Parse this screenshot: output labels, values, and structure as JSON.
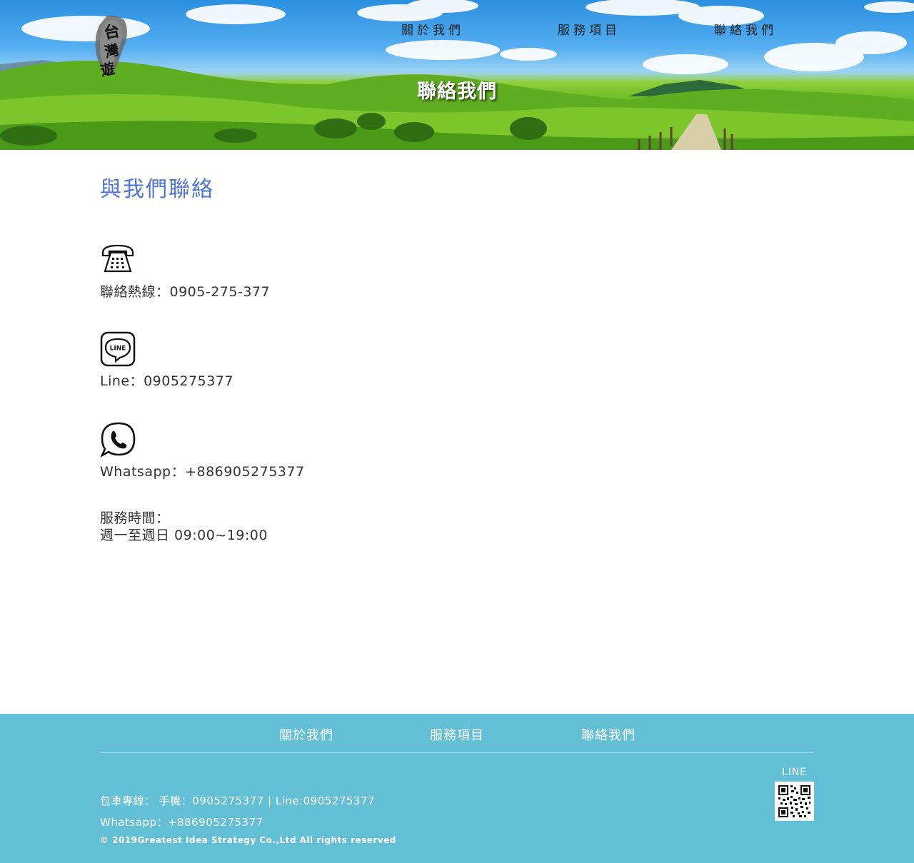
{
  "header": {
    "logo_text": "台灣遊",
    "nav": [
      "關於我們",
      "服務項目",
      "聯絡我們"
    ],
    "title": "聯絡我們"
  },
  "main": {
    "heading": "與我們聯絡",
    "contacts": [
      {
        "icon": "telephone-icon",
        "text": "聯絡熱線：0905-275-377"
      },
      {
        "icon": "line-icon",
        "text": "Line：0905275377"
      },
      {
        "icon": "whatsapp-icon",
        "text": "Whatsapp：+886905275377"
      }
    ],
    "hours_label": "服務時間：",
    "hours_value": "週一至週日 09:00~19:00"
  },
  "footer": {
    "nav": [
      "關於我們",
      "服務項目",
      "聯絡我們"
    ],
    "hotline": "包車專線： 手機：0905275377 | Line:0905275377",
    "whatsapp": "Whatsapp：+886905275377",
    "copyright": "© 2019Greatest Idea Strategy Co.,Ltd All rights reserved",
    "qr_label": "LINE"
  },
  "colors": {
    "heading_blue": "#4f74d6",
    "footer_bg": "#62bfd6"
  }
}
